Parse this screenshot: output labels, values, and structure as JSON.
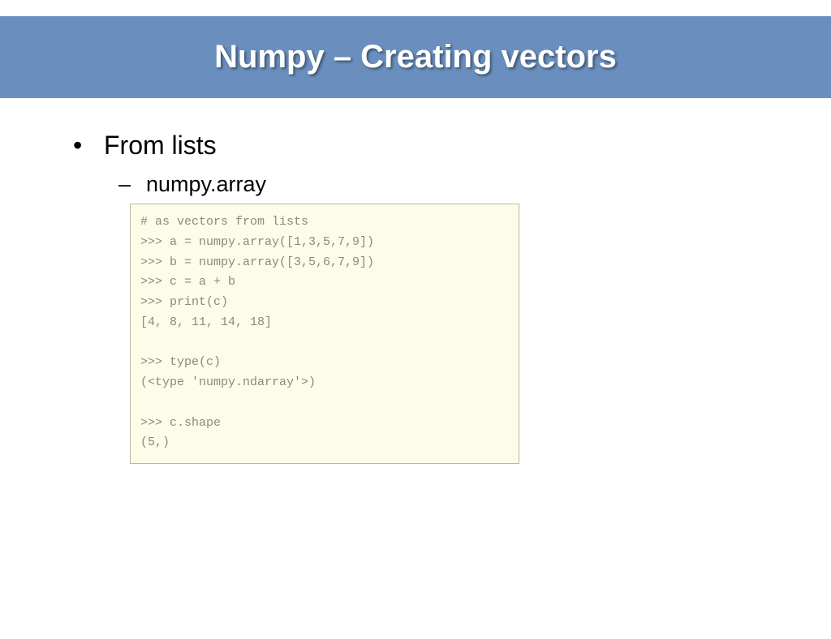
{
  "title": "Numpy – Creating vectors",
  "bullets": {
    "item1": "From lists",
    "sub1": "numpy.array"
  },
  "code": {
    "l0": "# as vectors from lists",
    "l1": ">>> a = numpy.array([1,3,5,7,9])",
    "l2": ">>> b = numpy.array([3,5,6,7,9])",
    "l3": ">>> c = a + b",
    "l4": ">>> print(c)",
    "l5": "[4, 8, 11, 14, 18]",
    "l6": "",
    "l7": ">>> type(c)",
    "l8": "(<type 'numpy.ndarray'>)",
    "l9": "",
    "l10": ">>> c.shape",
    "l11": "(5,)"
  }
}
